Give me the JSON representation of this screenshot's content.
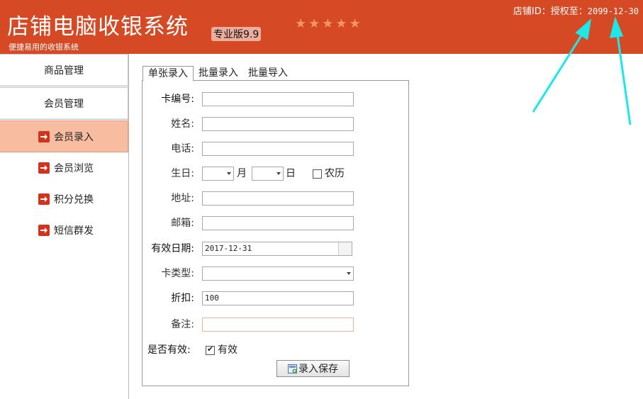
{
  "header": {
    "title": "店铺电脑收银系统",
    "edition": "专业版9.9",
    "subtitle": "便捷易用的收银系统",
    "stars": [
      "★",
      "★",
      "★",
      "★",
      "★"
    ],
    "license_label": "店铺ID：授权至：",
    "license_date": "2099-12-30"
  },
  "sidebar": {
    "groups": [
      "商品管理",
      "会员管理"
    ],
    "items": [
      {
        "label": "会员录入",
        "active": true
      },
      {
        "label": "会员浏览",
        "active": false
      },
      {
        "label": "积分兑换",
        "active": false
      },
      {
        "label": "短信群发",
        "active": false
      }
    ]
  },
  "tabs": [
    "单张录入",
    "批量录入",
    "批量导入"
  ],
  "form": {
    "card_no_label": "卡编号:",
    "card_no_value": "",
    "name_label": "姓名:",
    "name_value": "",
    "phone_label": "电话:",
    "phone_value": "",
    "birthday_label": "生日:",
    "month_unit": "月",
    "day_unit": "日",
    "lunar_label": "农历",
    "lunar_checked": false,
    "address_label": "地址:",
    "address_value": "",
    "email_label": "邮箱:",
    "email_value": "",
    "valid_date_label": "有效日期:",
    "valid_date_value": "2017-12-31",
    "card_type_label": "卡类型:",
    "card_type_value": "",
    "discount_label": "折扣:",
    "discount_value": "100",
    "remark_label": "备注:",
    "remark_value": "",
    "is_valid_label": "是否有效:",
    "valid_checkbox_label": "有效",
    "valid_checked": true,
    "save_button": "录入保存"
  },
  "colors": {
    "header_bg": "#d54a25",
    "active_nav_bg": "#f8bda0",
    "arrow_icon": "#d4321d"
  }
}
